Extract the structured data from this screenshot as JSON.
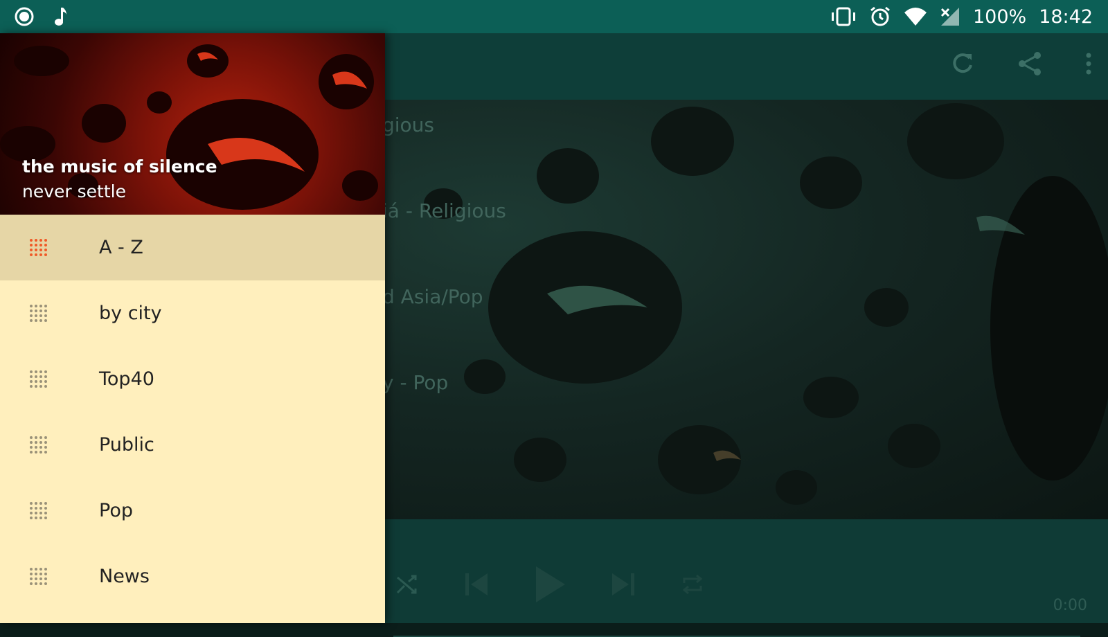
{
  "status_bar": {
    "battery": "100%",
    "time": "18:42"
  },
  "drawer": {
    "title": "the music of silence",
    "subtitle": "never settle",
    "items": [
      {
        "label": "A - Z",
        "active": true
      },
      {
        "label": "by city",
        "active": false
      },
      {
        "label": "Top40",
        "active": false
      },
      {
        "label": "Public",
        "active": false
      },
      {
        "label": "Pop",
        "active": false
      },
      {
        "label": "News",
        "active": false
      }
    ]
  },
  "main": {
    "genres": [
      "gious",
      "iá - Religious",
      "d Asia/Pop",
      "y - Pop"
    ],
    "player": {
      "time": "0:00"
    }
  },
  "colors": {
    "status_bar": "#0c5f56",
    "drawer_bg": "#ffefbd",
    "drawer_active": "#e6d6a6",
    "accent_icon": "#f05a28",
    "appbar": "#0e3e39"
  }
}
